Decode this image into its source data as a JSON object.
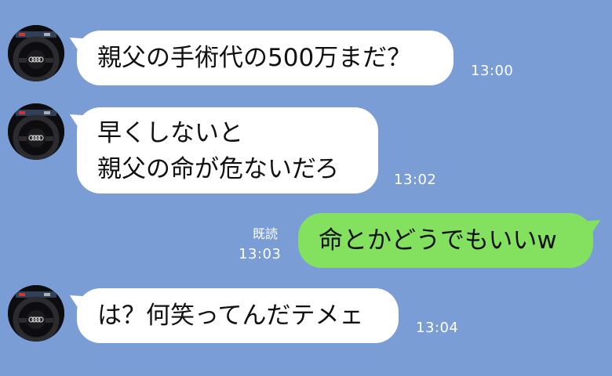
{
  "colors": {
    "background": "#7b9dd5",
    "incoming_bubble": "#ffffff",
    "outgoing_bubble": "#83e15f"
  },
  "avatar_icon": "car-steering-wheel-avatar",
  "messages": [
    {
      "side": "incoming",
      "text": "親父の手術代の500万まだ？",
      "time": "13:00"
    },
    {
      "side": "incoming",
      "lines": [
        "早くしないと",
        "親父の命が危ないだろ"
      ],
      "time": "13:02"
    },
    {
      "side": "outgoing",
      "text": "命とかどうでもいいw",
      "read": "既読",
      "time": "13:03"
    },
    {
      "side": "incoming",
      "text": "は？何笑ってんだテメェ",
      "time": "13:04"
    }
  ]
}
